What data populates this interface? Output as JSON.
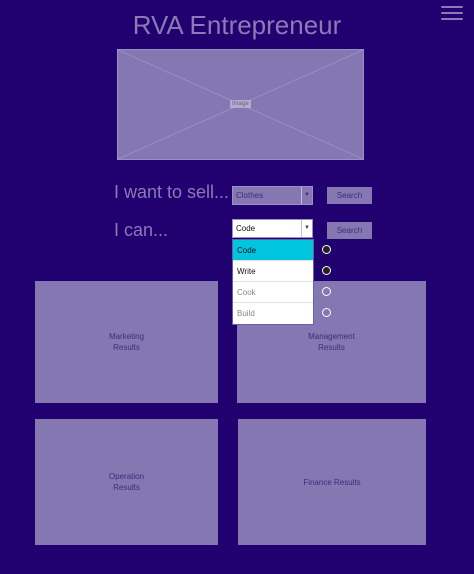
{
  "header": {
    "title": "RVA Entrepreneur"
  },
  "hero": {
    "image_label": "Image"
  },
  "sell_row": {
    "prompt": "I want to sell...",
    "select_value": "Clothes",
    "search_label": "Search"
  },
  "can_row": {
    "prompt": "I can...",
    "select_value": "Code",
    "search_label": "Search",
    "options": [
      "Code",
      "Write",
      "Cook",
      "Build"
    ]
  },
  "results": {
    "marketing_line1": "Marketing",
    "marketing_line2": "Results",
    "management_line1": "Management",
    "management_line2": "Results",
    "operation_line1": "Operation",
    "operation_line2": "Results",
    "finance": "Finance Results"
  },
  "colors": {
    "background": "#21006f",
    "panel": "#8577b2",
    "highlight": "#00c5dd"
  }
}
